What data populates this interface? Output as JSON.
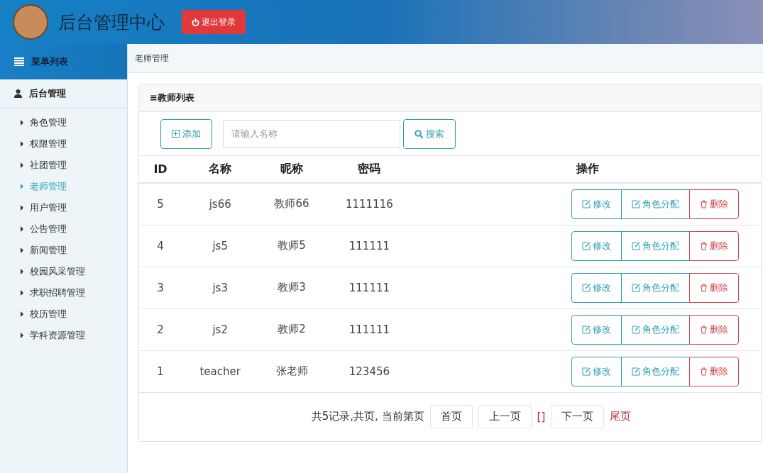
{
  "header": {
    "title": "后台管理中心",
    "logout": "退出登录"
  },
  "sidebar": {
    "title": "菜单列表",
    "group": "后台管理",
    "items": [
      {
        "label": "角色管理",
        "selected": false
      },
      {
        "label": "权限管理",
        "selected": false
      },
      {
        "label": "社团管理",
        "selected": false
      },
      {
        "label": "老师管理",
        "selected": true
      },
      {
        "label": "用户管理",
        "selected": false
      },
      {
        "label": "公告管理",
        "selected": false
      },
      {
        "label": "新闻管理",
        "selected": false
      },
      {
        "label": "校园风采管理",
        "selected": false
      },
      {
        "label": "求职招聘管理",
        "selected": false
      },
      {
        "label": "校历管理",
        "selected": false
      },
      {
        "label": "学科资源管理",
        "selected": false
      }
    ]
  },
  "breadcrumb": "老师管理",
  "panel": {
    "title": "≡教师列表",
    "add": "添加",
    "search": {
      "placeholder": "请输入名称"
    },
    "search_button": "搜索"
  },
  "table": {
    "columns": [
      "ID",
      "名称",
      "昵称",
      "密码",
      "操作"
    ],
    "rows": [
      {
        "cells": [
          "5",
          "js66",
          "教师66",
          "1111116"
        ],
        "actions": [
          {
            "kind": "edit",
            "label": "修改"
          },
          {
            "kind": "role",
            "label": "角色分配"
          },
          {
            "kind": "delete",
            "label": "删除"
          }
        ]
      },
      {
        "cells": [
          "4",
          "js5",
          "教师5",
          "111111"
        ],
        "actions": [
          {
            "kind": "edit",
            "label": "修改"
          },
          {
            "kind": "role",
            "label": "角色分配"
          },
          {
            "kind": "delete",
            "label": "删除"
          }
        ]
      },
      {
        "cells": [
          "3",
          "js3",
          "教师3",
          "111111"
        ],
        "actions": [
          {
            "kind": "edit",
            "label": "修改"
          },
          {
            "kind": "role",
            "label": "角色分配"
          },
          {
            "kind": "delete",
            "label": "删除"
          }
        ]
      },
      {
        "cells": [
          "2",
          "js2",
          "教师2",
          "111111"
        ],
        "actions": [
          {
            "kind": "edit",
            "label": "修改"
          },
          {
            "kind": "role",
            "label": "角色分配"
          },
          {
            "kind": "delete",
            "label": "删除"
          }
        ]
      },
      {
        "cells": [
          "1",
          "teacher",
          "张老师",
          "123456"
        ],
        "actions": [
          {
            "kind": "edit",
            "label": "修改"
          },
          {
            "kind": "role",
            "label": "角色分配"
          },
          {
            "kind": "delete",
            "label": "删除"
          }
        ]
      }
    ]
  },
  "pagination": {
    "summary": "共5记录,共页, 当前第页",
    "items": [
      {
        "kind": "button",
        "label": "首页"
      },
      {
        "kind": "button",
        "label": "上一页"
      },
      {
        "kind": "link",
        "label": "[]"
      },
      {
        "kind": "button",
        "label": "下一页"
      },
      {
        "kind": "link",
        "label": "尾页"
      }
    ]
  }
}
